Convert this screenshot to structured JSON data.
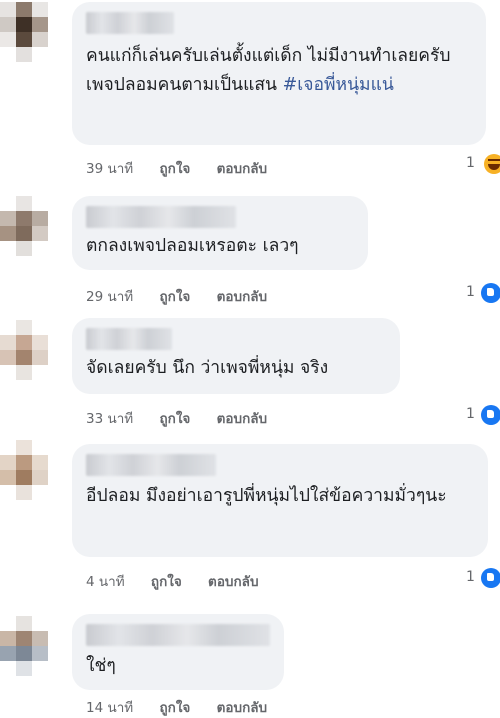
{
  "comments": [
    {
      "text": "คนแก่ก็เล่นครับเล่นตั้งแต่เด็ก ไม่มีงานทำเลยครับ เพจปลอมคนตามเป็นแสน ",
      "tag": "#เจอพี่หนุ่มแน่",
      "time": "39 นาที",
      "like": "ถูกใจ",
      "reply": "ตอบกลับ",
      "reaction_count": "1",
      "reaction_icon": "haha-reaction-icon"
    },
    {
      "text": "ตกลงเพจปลอมเหรอตะ เลวๆ",
      "time": "29 นาที",
      "like": "ถูกใจ",
      "reply": "ตอบกลับ",
      "reaction_count": "1",
      "reaction_icon": "like-reaction-icon"
    },
    {
      "text": "จัดเลยครับ นึก ว่าเพจพี่หนุ่ม จริง",
      "time": "33 นาที",
      "like": "ถูกใจ",
      "reply": "ตอบกลับ",
      "reaction_count": "1",
      "reaction_icon": "like-reaction-icon"
    },
    {
      "text": "อีปลอม มึงอย่าเอารูปพี่หนุ่มไปใส่ข้อความมั่วๆนะ",
      "time": "4 นาที",
      "like": "ถูกใจ",
      "reply": "ตอบกลับ",
      "reaction_count": "1",
      "reaction_icon": "like-reaction-icon"
    },
    {
      "text": "ใช่ๆ",
      "time": "14 นาที",
      "like": "ถูกใจ",
      "reply": "ตอบกลับ"
    }
  ],
  "colors": {
    "bubble": "#f0f2f5",
    "meta": "#65676b",
    "hashtag": "#385898",
    "like_blue": "#1877f2",
    "haha_yellow": "#f7b125"
  }
}
